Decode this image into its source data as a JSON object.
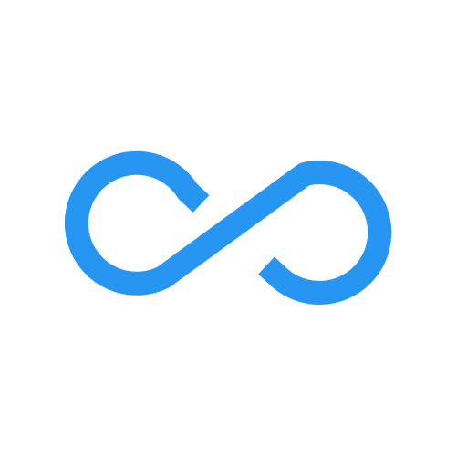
{
  "icon": {
    "name": "infinity-loop-icon",
    "color": "#2696F2",
    "background": "#ffffff"
  }
}
